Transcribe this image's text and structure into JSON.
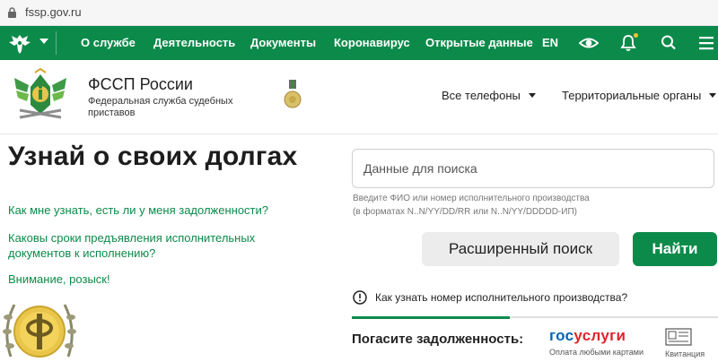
{
  "browser": {
    "url": "fssp.gov.ru"
  },
  "nav": {
    "items": [
      {
        "label": "О службе"
      },
      {
        "label": "Деятельность"
      },
      {
        "label": "Документы"
      },
      {
        "label": "Коронавирус"
      },
      {
        "label": "Открытые данные"
      },
      {
        "label": "EN"
      }
    ],
    "icons": [
      "eye-icon",
      "bell-icon",
      "search-icon",
      "menu-icon"
    ],
    "color": "#0c8a4a"
  },
  "header": {
    "org_name": "ФССП России",
    "org_subtitle": "Федеральная служба судебных приставов",
    "links": [
      {
        "label": "Все телефоны"
      },
      {
        "label": "Территориальные органы"
      }
    ]
  },
  "main": {
    "title": "Узнай о своих долгах",
    "links": [
      {
        "label": "Как мне узнать, есть ли у меня задолженности?"
      },
      {
        "label": "Каковы сроки предъявления исполнительных документов к исполнению?"
      },
      {
        "label": "Внимание, розыск!"
      }
    ],
    "search": {
      "placeholder": "Данные для поиска",
      "hint_line1": "Введите ФИО или номер исполнительного производства",
      "hint_line2": "(в форматах N..N/YY/DD/RR или N..N/YY/DDDDD-ИП)",
      "advanced_label": "Расширенный поиск",
      "find_label": "Найти"
    },
    "info_link": "Как узнать номер исполнительного производства?",
    "pay": {
      "label": "Погасите задолженность:",
      "gosuslugi_blue": "гос",
      "gosuslugi_red": "услуги",
      "gosuslugi_caption": "Оплата любыми картами",
      "receipt_label": "Квитанция"
    }
  },
  "colors": {
    "accent": "#0c8a4a",
    "brand_blue": "#0066b3",
    "brand_red": "#e0242b",
    "link": "#0c8a4a"
  }
}
